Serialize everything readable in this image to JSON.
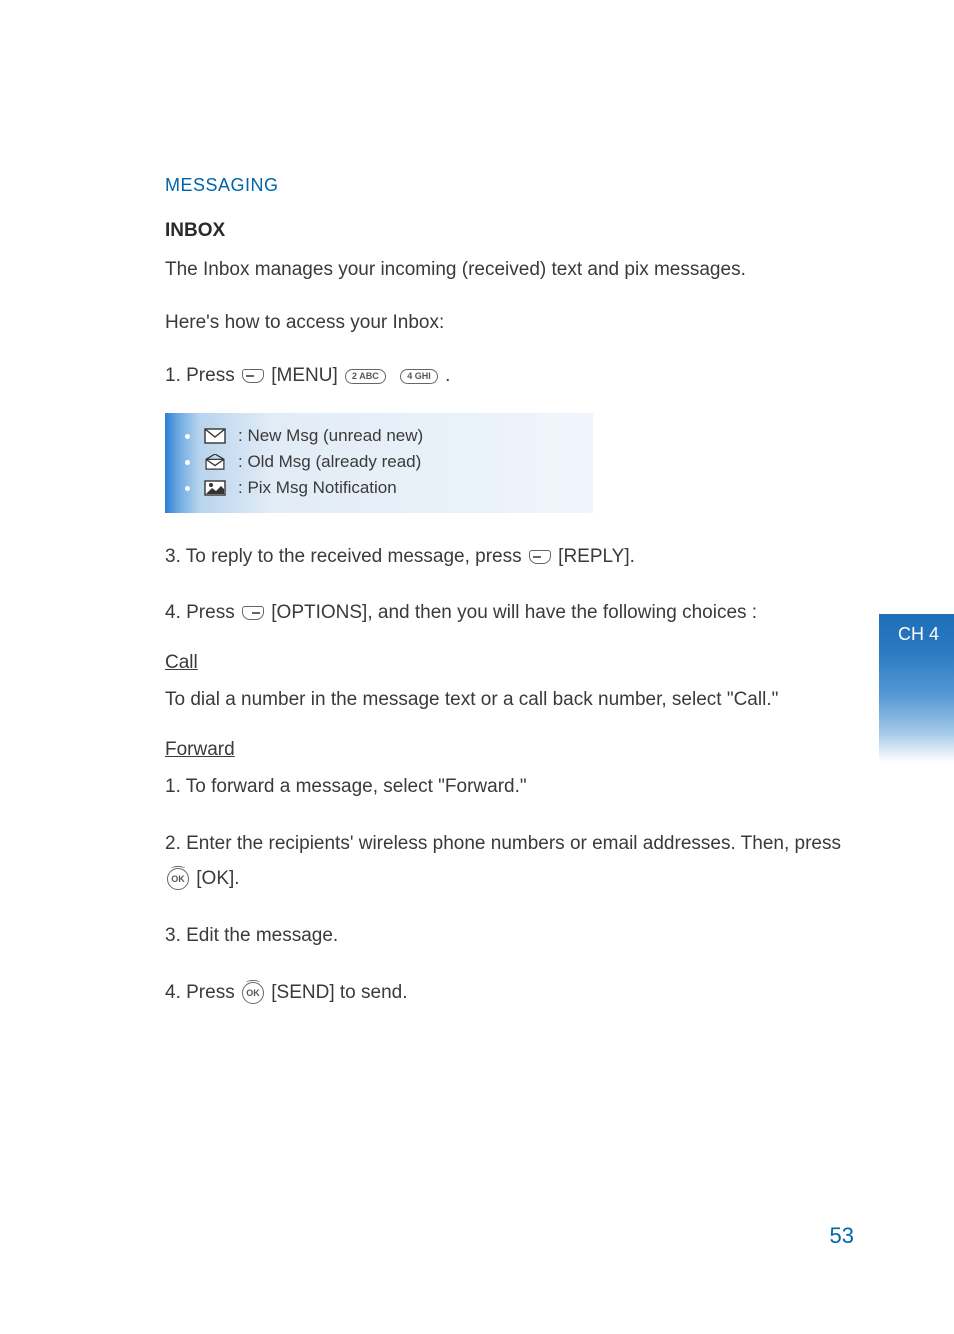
{
  "sectionTitle": "MESSAGING",
  "subsection": "INBOX",
  "intro1": "The Inbox manages your incoming (received) text and pix messages.",
  "intro2": "Here's how to access your Inbox:",
  "step1_prefix": "1. Press ",
  "step1_menu": " [MENU] ",
  "step1_suffix": " .",
  "key2": "2 ABC",
  "key4": "4 GHI",
  "icons": [
    {
      "label": ": New Msg (unread new)"
    },
    {
      "label": ": Old Msg (already read)"
    },
    {
      "label": ": Pix Msg Notification"
    }
  ],
  "step3_prefix": "3. To reply to the received message, press ",
  "step3_suffix": " [REPLY].",
  "step4_prefix": "4. Press ",
  "step4_suffix": " [OPTIONS], and then you will have the following choices :",
  "callTitle": "Call",
  "callBody": "To dial a number in the message text or a call back number, select \"Call.\"",
  "forwardTitle": "Forward",
  "fwd1": "1. To forward a message, select \"Forward.\"",
  "fwd2_prefix": "2. Enter the recipients' wireless phone numbers or email addresses. Then, press ",
  "fwd2_suffix": " [OK].",
  "fwd3": "3. Edit the message.",
  "fwd4_prefix": "4. Press ",
  "fwd4_suffix": " [SEND] to send.",
  "okLabel": "OK",
  "chapterTab": "CH 4",
  "pageNumber": "53"
}
